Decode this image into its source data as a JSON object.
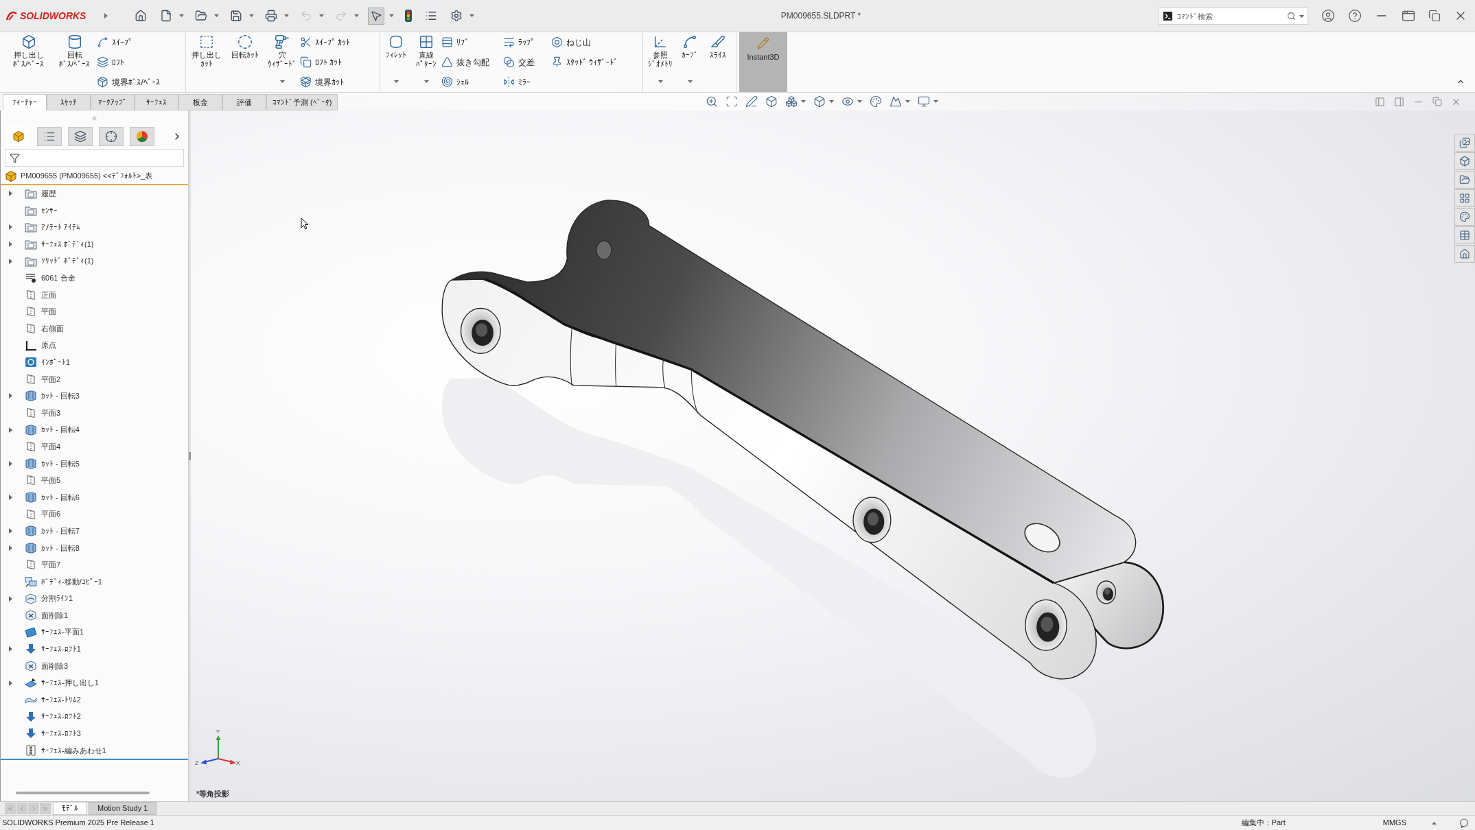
{
  "title_bar": {
    "logo_text": "SOLIDWORKS",
    "quick_access": [
      {
        "selected": false,
        "disabled": false
      },
      {
        "selected": false,
        "disabled": false
      },
      {
        "selected": false,
        "disabled": false
      },
      {
        "selected": false,
        "disabled": false
      },
      {
        "selected": false,
        "disabled": false
      },
      {
        "selected": false,
        "disabled": true
      },
      {
        "selected": false,
        "disabled": true
      },
      {
        "selected": true,
        "disabled": false
      },
      {
        "selected": false,
        "disabled": false
      },
      {
        "selected": false,
        "disabled": false
      },
      {
        "selected": false,
        "disabled": false
      }
    ],
    "document_title": "PM009655.SLDPRT *",
    "search": {
      "placeholder": "ｺﾏﾝﾄﾞ検索"
    }
  },
  "ribbon": {
    "groups": [
      {
        "large": [
          {
            "lines": [
              "押し出し",
              "ﾎﾞｽ/ﾍﾞｰｽ"
            ],
            "dropdown": false
          },
          {
            "lines": [
              "回転",
              "ﾎﾞｽ/ﾍﾞｰｽ"
            ],
            "dropdown": false
          }
        ],
        "columns": [
          [
            "ｽｲｰﾌﾟ",
            "ﾛﾌﾄ",
            "境界ﾎﾞｽ/ﾍﾞｰｽ"
          ]
        ]
      },
      {
        "large": [
          {
            "lines": [
              "押し出し",
              "ｶｯﾄ"
            ],
            "dropdown": false
          },
          {
            "lines": [
              "回転ｶｯﾄ"
            ],
            "dropdown": false
          },
          {
            "lines": [
              "穴",
              "ｳｨｻﾞｰﾄﾞ"
            ],
            "dropdown": true
          }
        ],
        "columns": [
          [
            "ｽｲｰﾌﾟ ｶｯﾄ",
            "ﾛﾌﾄ ｶｯﾄ",
            "境界ｶｯﾄ"
          ]
        ]
      },
      {
        "large": [
          {
            "lines": [
              "ﾌｨﾚｯﾄ"
            ],
            "dropdown": true
          },
          {
            "lines": [
              "直線",
              "ﾊﾟﾀｰﾝ"
            ],
            "dropdown": true
          }
        ],
        "columns": [
          [
            "ﾘﾌﾞ",
            "抜き勾配",
            "ｼｪﾙ"
          ],
          [
            "ﾗｯﾌﾟ",
            "交差",
            "ﾐﾗｰ"
          ],
          [
            "ねじ山",
            "ｽﾀｯﾄﾞ ｳｨｻﾞｰﾄﾞ"
          ]
        ]
      },
      {
        "large": [
          {
            "lines": [
              "参照",
              "ｼﾞｵﾒﾄﾘ"
            ],
            "dropdown": true
          },
          {
            "lines": [
              "ｶｰﾌﾞ"
            ],
            "dropdown": true
          },
          {
            "lines": [
              "ｽﾗｲｽ"
            ],
            "dropdown": false
          }
        ]
      }
    ],
    "instant3d": {
      "label": "Instant3D",
      "on": true
    }
  },
  "command_tabs": [
    {
      "label": "ﾌｨｰﾁｬｰ",
      "selected": true
    },
    {
      "label": "ｽｹｯﾁ",
      "selected": false
    },
    {
      "label": "ﾏｰｸｱｯﾌﾟ",
      "selected": false
    },
    {
      "label": "ｻｰﾌｪｽ",
      "selected": false
    },
    {
      "label": "板金",
      "selected": false
    },
    {
      "label": "評価",
      "selected": false
    },
    {
      "label": "ｺﾏﾝﾄﾞ予測 (ﾍﾞｰﾀ)",
      "selected": false
    }
  ],
  "feature_manager": {
    "panel_tabs": [
      {
        "selected": true
      },
      {
        "selected": false
      },
      {
        "selected": false
      },
      {
        "selected": false
      },
      {
        "selected": false
      }
    ],
    "root": {
      "label": "PM009655 (PM009655) <<ﾃﾞﾌｫﾙﾄ>_表"
    },
    "tree": [
      {
        "kind": "folder",
        "label": "履歴",
        "expandable": true
      },
      {
        "kind": "folder",
        "label": "ｾﾝｻｰ",
        "expandable": false
      },
      {
        "kind": "folder",
        "label": "ｱﾉﾃｰﾄ ｱｲﾃﾑ",
        "expandable": true
      },
      {
        "kind": "folder",
        "label": "ｻｰﾌｪｽ ﾎﾞﾃﾞｨ(1)",
        "expandable": true
      },
      {
        "kind": "folder",
        "label": "ｿﾘｯﾄﾞ ﾎﾞﾃﾞｨ(1)",
        "expandable": true
      },
      {
        "kind": "material",
        "label": "6061 合金",
        "expandable": false
      },
      {
        "kind": "plane",
        "label": "正面",
        "expandable": false
      },
      {
        "kind": "plane",
        "label": "平面",
        "expandable": false
      },
      {
        "kind": "plane",
        "label": "右側面",
        "expandable": false
      },
      {
        "kind": "origin",
        "label": "原点",
        "expandable": false
      },
      {
        "kind": "import",
        "label": "ｲﾝﾎﾟｰﾄ1",
        "expandable": false
      },
      {
        "kind": "plane",
        "label": "平面2",
        "expandable": false
      },
      {
        "kind": "cut",
        "label": "ｶｯﾄ - 回転3",
        "expandable": true
      },
      {
        "kind": "plane",
        "label": "平面3",
        "expandable": false
      },
      {
        "kind": "cut",
        "label": "ｶｯﾄ - 回転4",
        "expandable": true
      },
      {
        "kind": "plane",
        "label": "平面4",
        "expandable": false
      },
      {
        "kind": "cut",
        "label": "ｶｯﾄ - 回転5",
        "expandable": true
      },
      {
        "kind": "plane",
        "label": "平面5",
        "expandable": false
      },
      {
        "kind": "cut",
        "label": "ｶｯﾄ - 回転6",
        "expandable": true
      },
      {
        "kind": "plane",
        "label": "平面6",
        "expandable": false
      },
      {
        "kind": "cut",
        "label": "ｶｯﾄ - 回転7",
        "expandable": true
      },
      {
        "kind": "cut",
        "label": "ｶｯﾄ - 回転8",
        "expandable": true
      },
      {
        "kind": "plane",
        "label": "平面7",
        "expandable": false
      },
      {
        "kind": "move",
        "label": "ﾎﾞﾃﾞｨ-移動/ｺﾋﾟｰ1",
        "expandable": false
      },
      {
        "kind": "split",
        "label": "分割ﾗｲﾝ1",
        "expandable": true
      },
      {
        "kind": "delete-face",
        "label": "面削除1",
        "expandable": false
      },
      {
        "kind": "surface-plane",
        "label": "ｻｰﾌｪｽ-平面1",
        "expandable": false
      },
      {
        "kind": "loft",
        "label": "ｻｰﾌｪｽ-ﾛﾌﾄ1",
        "expandable": true
      },
      {
        "kind": "delete-face",
        "label": "面削除3",
        "expandable": false
      },
      {
        "kind": "extrude",
        "label": "ｻｰﾌｪｽ-押し出し1",
        "expandable": true
      },
      {
        "kind": "trim",
        "label": "ｻｰﾌｪｽ-ﾄﾘﾑ2",
        "expandable": false
      },
      {
        "kind": "loft",
        "label": "ｻｰﾌｪｽ-ﾛﾌﾄ2",
        "expandable": false
      },
      {
        "kind": "loft",
        "label": "ｻｰﾌｪｽ-ﾛﾌﾄ3",
        "expandable": false
      },
      {
        "kind": "knit",
        "label": "ｻｰﾌｪｽ-編みあわせ1",
        "expandable": false
      }
    ]
  },
  "graphics_area": {
    "triad_labels": {
      "y": "Y",
      "x": "X",
      "z": "Z"
    },
    "view_name": "*等角投影"
  },
  "bottom_tabs": [
    {
      "label": "ﾓﾃﾞﾙ",
      "selected": true
    },
    {
      "label": "Motion Study 1",
      "selected": false
    }
  ],
  "status_bar": {
    "product": "SOLIDWORKS Premium 2025 Pre Release 1",
    "mode": "編集中：Part",
    "units": "MMGS"
  }
}
